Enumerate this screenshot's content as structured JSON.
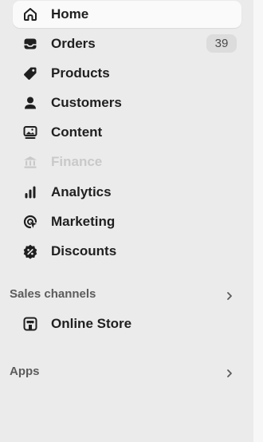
{
  "nav": {
    "items": [
      {
        "label": "Home",
        "icon": "home-icon",
        "active": true
      },
      {
        "label": "Orders",
        "icon": "inbox-icon",
        "badge": "39"
      },
      {
        "label": "Products",
        "icon": "tag-icon"
      },
      {
        "label": "Customers",
        "icon": "person-icon"
      },
      {
        "label": "Content",
        "icon": "image-icon"
      },
      {
        "label": "Finance",
        "icon": "bank-icon",
        "disabled": true
      },
      {
        "label": "Analytics",
        "icon": "bar-chart-icon"
      },
      {
        "label": "Marketing",
        "icon": "target-icon"
      },
      {
        "label": "Discounts",
        "icon": "discount-icon"
      }
    ]
  },
  "sales_channels": {
    "heading": "Sales channels",
    "items": [
      {
        "label": "Online Store",
        "icon": "store-icon"
      }
    ]
  },
  "apps": {
    "heading": "Apps"
  },
  "colors": {
    "sidebar_bg": "#ebebeb",
    "active_bg": "#fafafa",
    "text": "#1f1f1f",
    "disabled_text": "#c9c9c9",
    "section_text": "#5c5c5c",
    "badge_bg": "#dcdcdc"
  }
}
